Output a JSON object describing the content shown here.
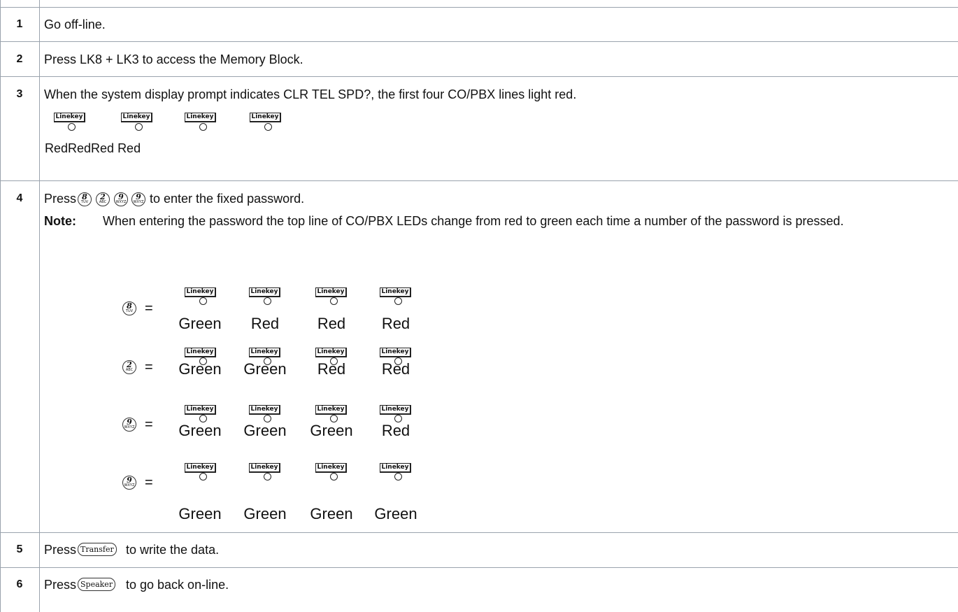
{
  "steps": [
    {
      "num": "1",
      "text": "Go off-line."
    },
    {
      "num": "2",
      "text": "Press LK8 + LK3 to access the Memory Block."
    },
    {
      "num": "3",
      "text": "When the system display prompt indicates CLR TEL SPD?, the first four CO/PBX lines light red.",
      "led_caption": "RedRedRed Red"
    },
    {
      "num": "4",
      "press_label": "Press",
      "after_keys": "to enter the fixed password.",
      "keys": [
        {
          "digit": "8",
          "letters": "TUV"
        },
        {
          "digit": "2",
          "letters": "ABC"
        },
        {
          "digit": "9",
          "letters": "WXYZ"
        },
        {
          "digit": "9",
          "letters": "WXYZ"
        }
      ],
      "note_label": "Note:",
      "note_text": "When entering the password the top line of CO/PBX LEDs change from red to green each time a number of the password is pressed.",
      "equals": "=",
      "rows": [
        {
          "digit": "8",
          "letters": "TUV",
          "states": [
            "Green",
            "Red",
            "Red",
            "Red"
          ]
        },
        {
          "digit": "2",
          "letters": "ABC",
          "states": [
            "Green",
            "Green",
            "Red",
            "Red"
          ]
        },
        {
          "digit": "9",
          "letters": "WXYZ",
          "states": [
            "Green",
            "Green",
            "Green",
            "Red"
          ]
        },
        {
          "digit": "9",
          "letters": "WXYZ",
          "states": [
            "Green",
            "Green",
            "Green",
            "Green"
          ]
        }
      ]
    },
    {
      "num": "5",
      "press": "Press",
      "key": "Transfer",
      "after": "to write the data."
    },
    {
      "num": "6",
      "press": "Press",
      "key": "Speaker",
      "after": "to go back on-line."
    }
  ],
  "linekey_label": "Linekey"
}
